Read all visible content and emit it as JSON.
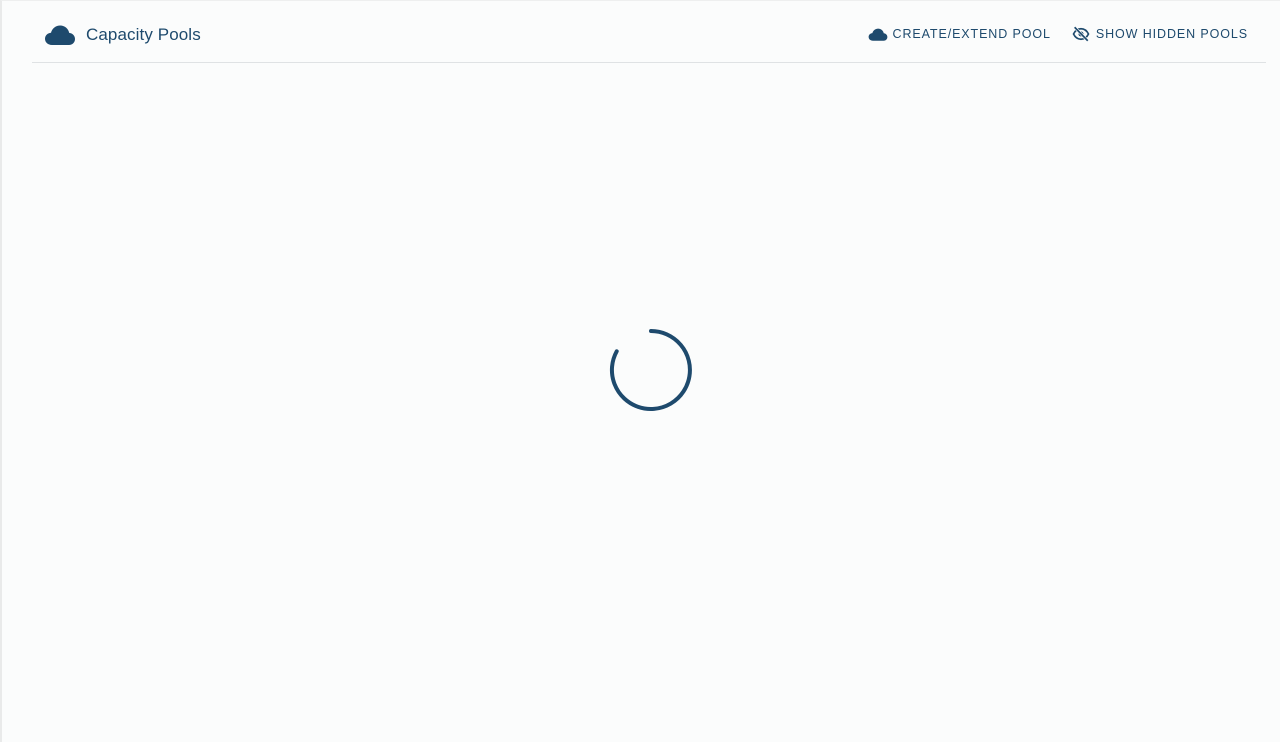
{
  "header": {
    "title": "Capacity Pools",
    "title_icon": "cloud-icon"
  },
  "actions": [
    {
      "label": "CREATE/EXTEND POOL",
      "icon": "cloud-icon"
    },
    {
      "label": "SHOW HIDDEN POOLS",
      "icon": "eye-off-icon"
    }
  ],
  "status": {
    "loading": true,
    "indicator_icon": "loading-spinner-icon"
  },
  "colors": {
    "accent": "#1e4a6d",
    "background": "#fbfcfc",
    "divider": "#dfe2e4"
  }
}
